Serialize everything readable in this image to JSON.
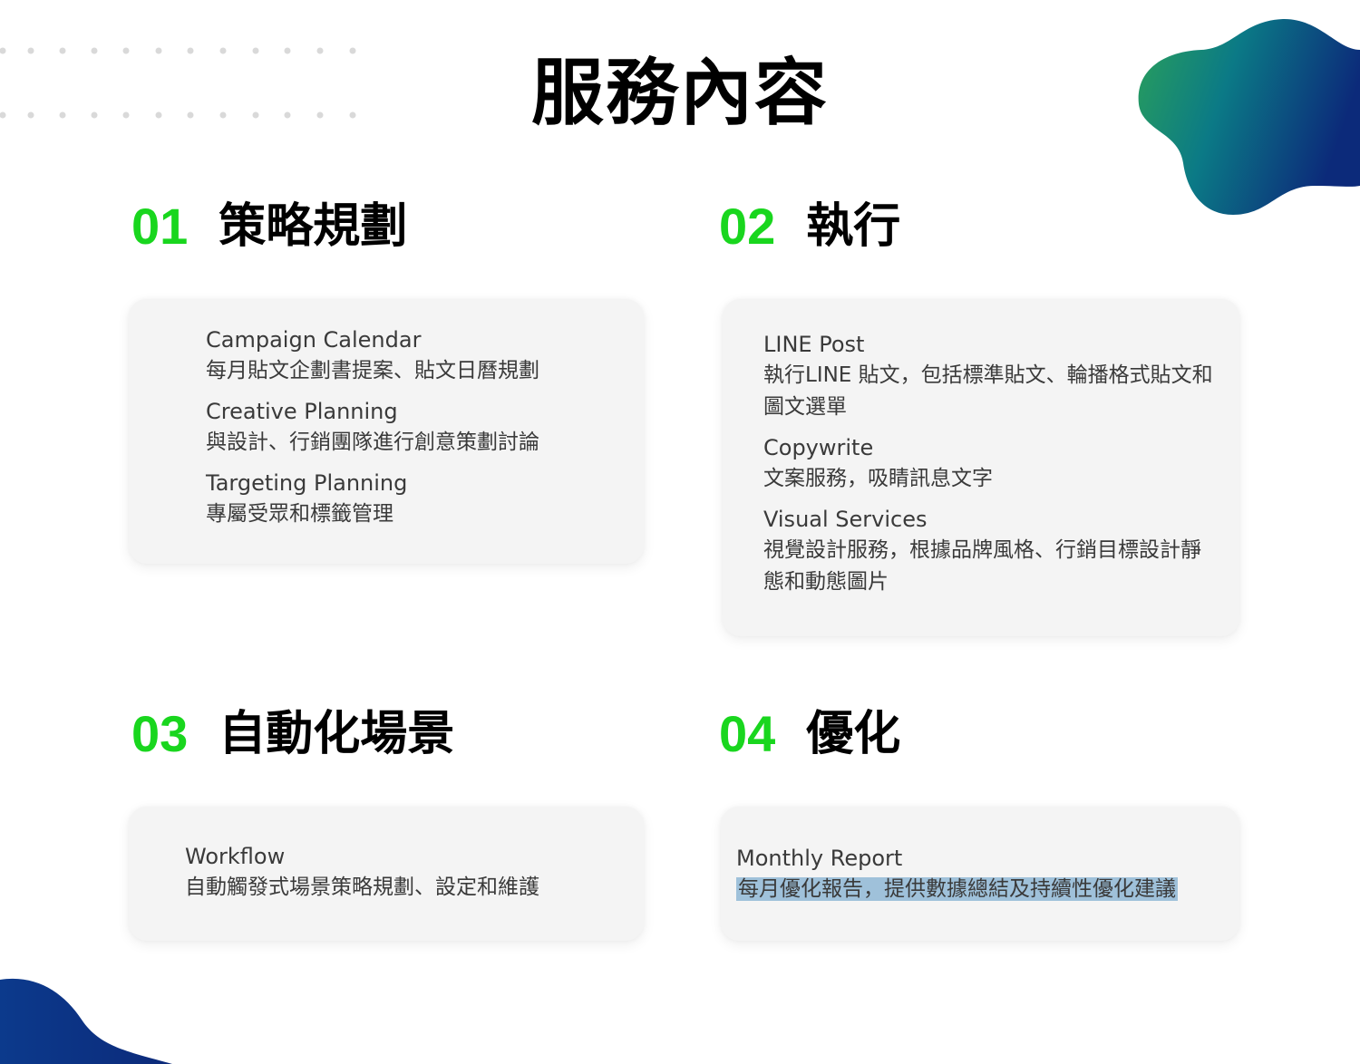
{
  "page": {
    "title": "服務內容"
  },
  "colors": {
    "accent_green": "#19d61e",
    "blob_start": "#2aa05a",
    "blob_end": "#0c2a7a",
    "highlight": "#9fc1da"
  },
  "sections": [
    {
      "number": "01",
      "title": "策略規劃",
      "items": [
        {
          "title": "Campaign Calendar",
          "desc": "每月貼文企劃書提案、貼文日曆規劃"
        },
        {
          "title": "Creative Planning",
          "desc": "與設計、行銷團隊進行創意策劃討論"
        },
        {
          "title": "Targeting Planning",
          "desc": "專屬受眾和標籤管理"
        }
      ]
    },
    {
      "number": "02",
      "title": "執行",
      "items": [
        {
          "title": "LINE Post",
          "desc": "執行LINE 貼文，包括標準貼文、輪播格式貼文和圖文選單"
        },
        {
          "title": "Copywrite",
          "desc": "文案服務，吸睛訊息文字"
        },
        {
          "title": "Visual Services",
          "desc": "視覺設計服務，根據品牌風格、行銷目標設計靜態和動態圖片"
        }
      ]
    },
    {
      "number": "03",
      "title": "自動化場景",
      "items": [
        {
          "title": "Workflow",
          "desc": "自動觸發式場景策略規劃、設定和維護"
        }
      ]
    },
    {
      "number": "04",
      "title": "優化",
      "items": [
        {
          "title": "Monthly Report",
          "desc": "每月優化報告，提供數據總結及持續性優化建議"
        }
      ]
    }
  ]
}
